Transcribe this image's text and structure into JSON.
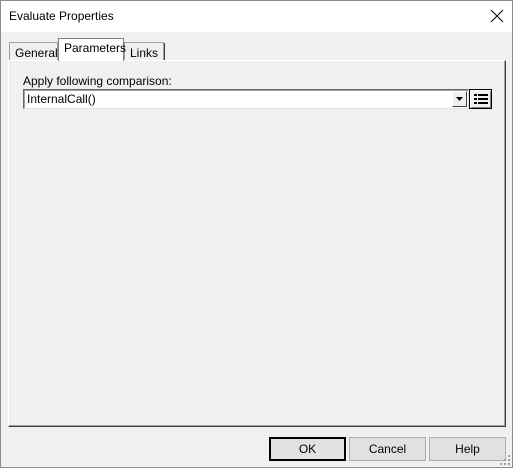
{
  "window": {
    "title": "Evaluate Properties"
  },
  "tabs": [
    {
      "label": "General"
    },
    {
      "label": "Parameters"
    },
    {
      "label": "Links"
    }
  ],
  "parameters": {
    "comparison_label": "Apply following comparison:",
    "comparison_value": "InternalCall()"
  },
  "buttons": {
    "ok": "OK",
    "cancel": "Cancel",
    "help": "Help"
  },
  "icons": {
    "close": "close-icon",
    "dropdown": "chevron-down-icon",
    "list": "list-icon",
    "grip": "resize-grip-icon"
  }
}
